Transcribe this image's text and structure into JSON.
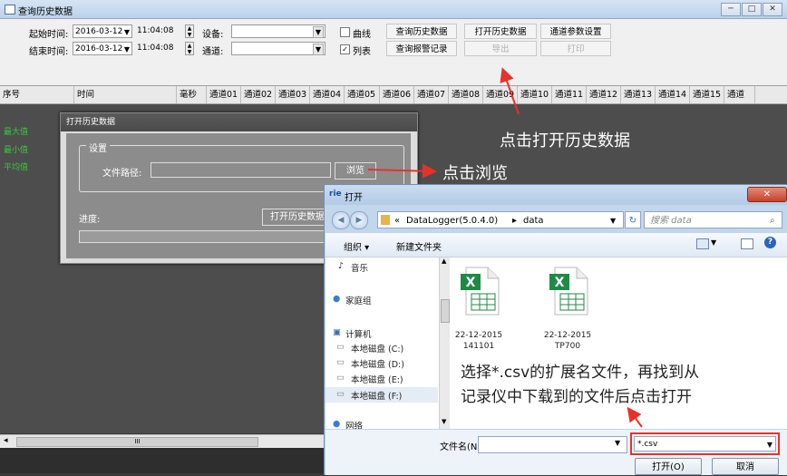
{
  "window": {
    "title": "查询历史数据",
    "min": "─",
    "max": "□",
    "close": "✕"
  },
  "toolbar": {
    "start_label": "起始时间:",
    "end_label": "结束时间:",
    "start_date": "2016-03-12",
    "start_time": "11:04:08",
    "end_date": "2016-03-12",
    "end_time": "11:04:08",
    "device_label": "设备:",
    "channel_label": "通道:",
    "curve_label": "曲线",
    "list_label": "列表",
    "query_history": "查询历史数据",
    "open_history": "打开历史数据",
    "channel_params": "通道参数设置",
    "query_alarm": "查询报警记录",
    "export": "导出",
    "print": "打印"
  },
  "grid": {
    "columns": [
      "序号",
      "时间",
      "毫秒",
      "通道01",
      "通道02",
      "通道03",
      "通道04",
      "通道05",
      "通道06",
      "通道07",
      "通道08",
      "通道09",
      "通道10",
      "通道11",
      "通道12",
      "通道13",
      "通道14",
      "通道15",
      "通道"
    ],
    "row_labels": [
      "最大值",
      "最小值",
      "平均值"
    ]
  },
  "scroll": {
    "left": "◂",
    "thumb": "III",
    "right": "▸"
  },
  "open_dialog": {
    "title": "打开历史数据",
    "group": "设置",
    "path_label": "文件路径:",
    "browse": "浏览",
    "progress_label": "进度:",
    "open_btn": "打开历史数据"
  },
  "file_dialog": {
    "title": "打开",
    "path_prefix": "«",
    "path1": "DataLogger(5.0.4.0)",
    "sep": "▸",
    "path2": "data",
    "search_placeholder": "搜索 data",
    "organize": "组织 ▾",
    "new_folder": "新建文件夹",
    "nav": [
      "音乐",
      "家庭组",
      "计算机",
      "本地磁盘 (C:)",
      "本地磁盘 (D:)",
      "本地磁盘 (E:)",
      "本地磁盘 (F:)",
      "网络"
    ],
    "files": [
      {
        "line1": "22-12-2015",
        "line2": "141101"
      },
      {
        "line1": "22-12-2015",
        "line2": "TP700"
      }
    ],
    "filename_label": "文件名(N):",
    "filter": "*.csv",
    "open": "打开(O)",
    "cancel": "取消"
  },
  "annotations": {
    "a1": "点击打开历史数据",
    "a2": "点击浏览",
    "a3_line1": "选择*.csv的扩展名文件，再找到从",
    "a3_line2": "记录仪中下载到的文件后点击打开"
  },
  "colors": {
    "annotation_arrow": "#e8312a",
    "highlight_box": "#e8312a",
    "row_label": "#3cc63c"
  }
}
